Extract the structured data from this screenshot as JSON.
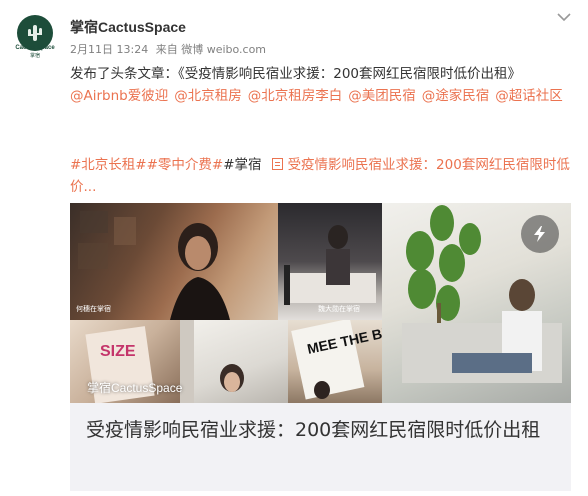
{
  "account": {
    "avatar_label": "Cactus Space",
    "avatar_sub": "掌宿",
    "name": "掌宿CactusSpace",
    "date": "2月11日 13:24",
    "source": "来自 微博 weibo.com"
  },
  "post": {
    "intro": "发布了头条文章：《受疫情影响民宿业求援：200套网红民宿限时低价出租》",
    "mentions": [
      "@Airbnb爱彼迎",
      "@北京租房",
      "@北京租房李白",
      "@美团民宿",
      "@途家民宿",
      "@超话社区"
    ],
    "topics": [
      "#北京长租#",
      "#零中介费#"
    ],
    "plain_topic": "#掌宿",
    "article_link": "受疫情影响民宿业求援：200套网红民宿限时低价..."
  },
  "card": {
    "photo_captions": [
      "何穗在掌宿",
      "魏大勋在掌宿"
    ],
    "magazine_text": "SIZE",
    "poster_text": "MEE THE BEST",
    "overlay_title": "掌宿CactusSpace",
    "title": "受疫情影响民宿业求援：200套网红民宿限时低价出租"
  },
  "icons": {
    "chevron": "chevron-down-icon",
    "share": "lightning-share-icon",
    "article": "article-doc-icon",
    "avatar": "cactus-logo-icon"
  },
  "colors": {
    "link": "#eb7350",
    "brand": "#1d4d3a"
  }
}
